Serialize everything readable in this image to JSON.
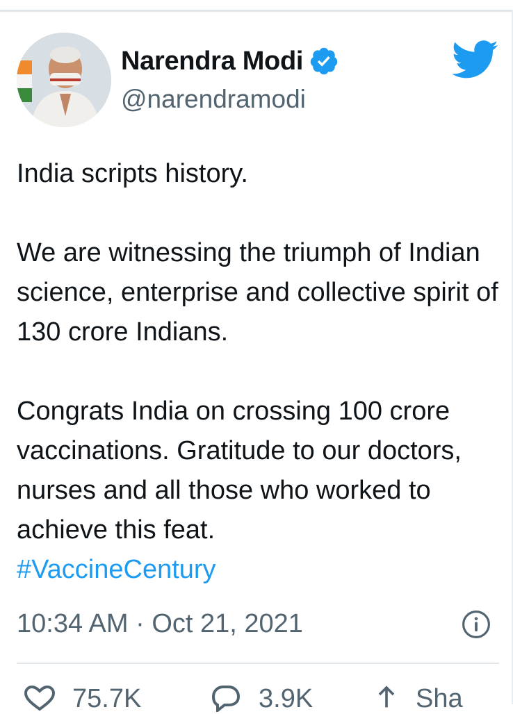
{
  "user": {
    "name": "Narendra Modi",
    "handle": "@narendramodi",
    "verified": true
  },
  "tweet": {
    "paragraphs": [
      "India scripts history.",
      "We are witnessing the triumph of Indian science, enterprise and collective spirit of 130 crore Indians.",
      "Congrats India on crossing 100 crore vaccinations. Gratitude to our doctors, nurses and all those who worked to achieve this feat."
    ],
    "hashtag": "#VaccineCentury",
    "timestamp": "10:34 AM · Oct 21, 2021"
  },
  "actions": {
    "likes": "75.7K",
    "replies": "3.9K",
    "share": "Sha"
  },
  "colors": {
    "accent": "#1d9bf0",
    "text": "#0f1419",
    "muted": "#536471"
  },
  "icons": [
    "verified-badge-icon",
    "twitter-bird-icon",
    "info-icon",
    "heart-icon",
    "reply-icon",
    "share-icon"
  ]
}
